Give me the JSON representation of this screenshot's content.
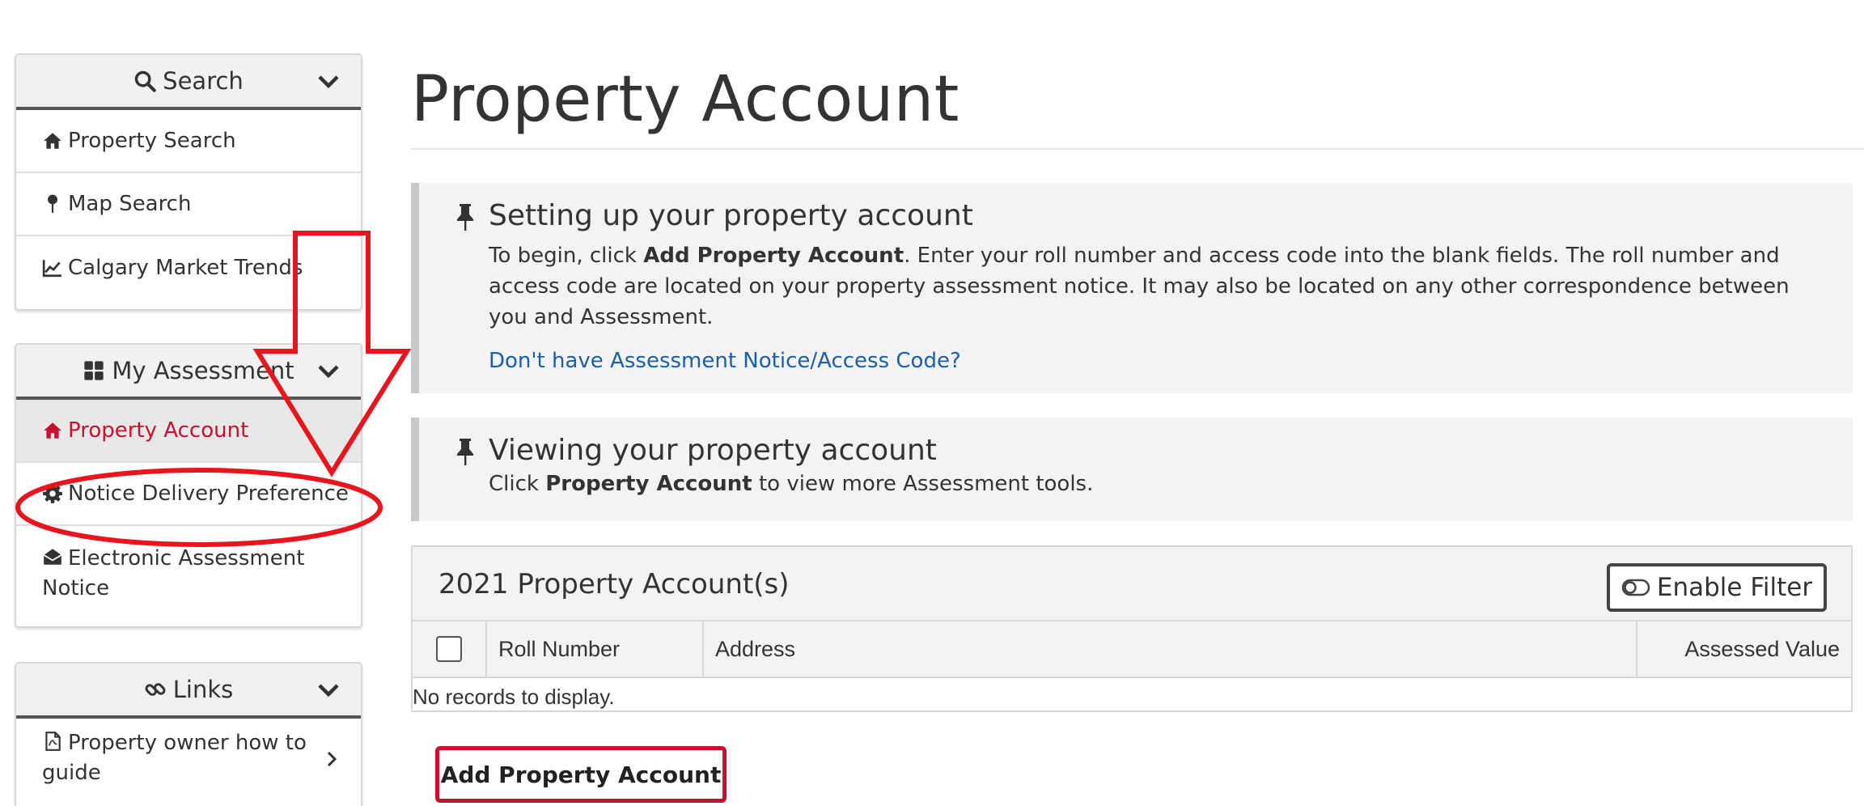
{
  "sidebar": {
    "search": {
      "title": "Search",
      "items": [
        {
          "label": "Property Search",
          "icon": "home-icon"
        },
        {
          "label": "Map Search",
          "icon": "map-pin-icon"
        },
        {
          "label": "Calgary Market Trends",
          "icon": "line-chart-icon"
        }
      ]
    },
    "assessment": {
      "title": "My Assessment",
      "items": [
        {
          "label": "Property Account",
          "icon": "home-icon",
          "active": true
        },
        {
          "label": "Notice Delivery Preference",
          "icon": "gear-icon"
        },
        {
          "label": "Electronic Assessment Notice",
          "icon": "envelope-open-icon"
        }
      ]
    },
    "links": {
      "title": "Links",
      "items": [
        {
          "label": "Property owner how to guide",
          "icon": "pdf-file-icon"
        }
      ]
    }
  },
  "main": {
    "title": "Property Account",
    "setup": {
      "heading": "Setting up your property account",
      "text_before": "To begin, click ",
      "text_bold": "Add Property Account",
      "text_after": ". Enter your roll number and access code into the blank fields. The roll number and access code are located on your property assessment notice. It may also be located on any other correspondence between you and Assessment.",
      "link": "Don't have Assessment Notice/Access Code?"
    },
    "viewing": {
      "heading": "Viewing your property account",
      "text_before": "Click ",
      "text_bold": "Property Account",
      "text_after": " to view more Assessment tools."
    },
    "accounts": {
      "title": "2021 Property Account(s)",
      "filter_label": "Enable Filter",
      "columns": [
        "Roll Number",
        "Address",
        "Assessed Value"
      ],
      "empty_message": "No records to display."
    },
    "add_button": "Add Property Account"
  },
  "colors": {
    "accent_red": "#c8102e",
    "link_blue": "#1a5fa8",
    "annotation_red": "#e8141e"
  }
}
